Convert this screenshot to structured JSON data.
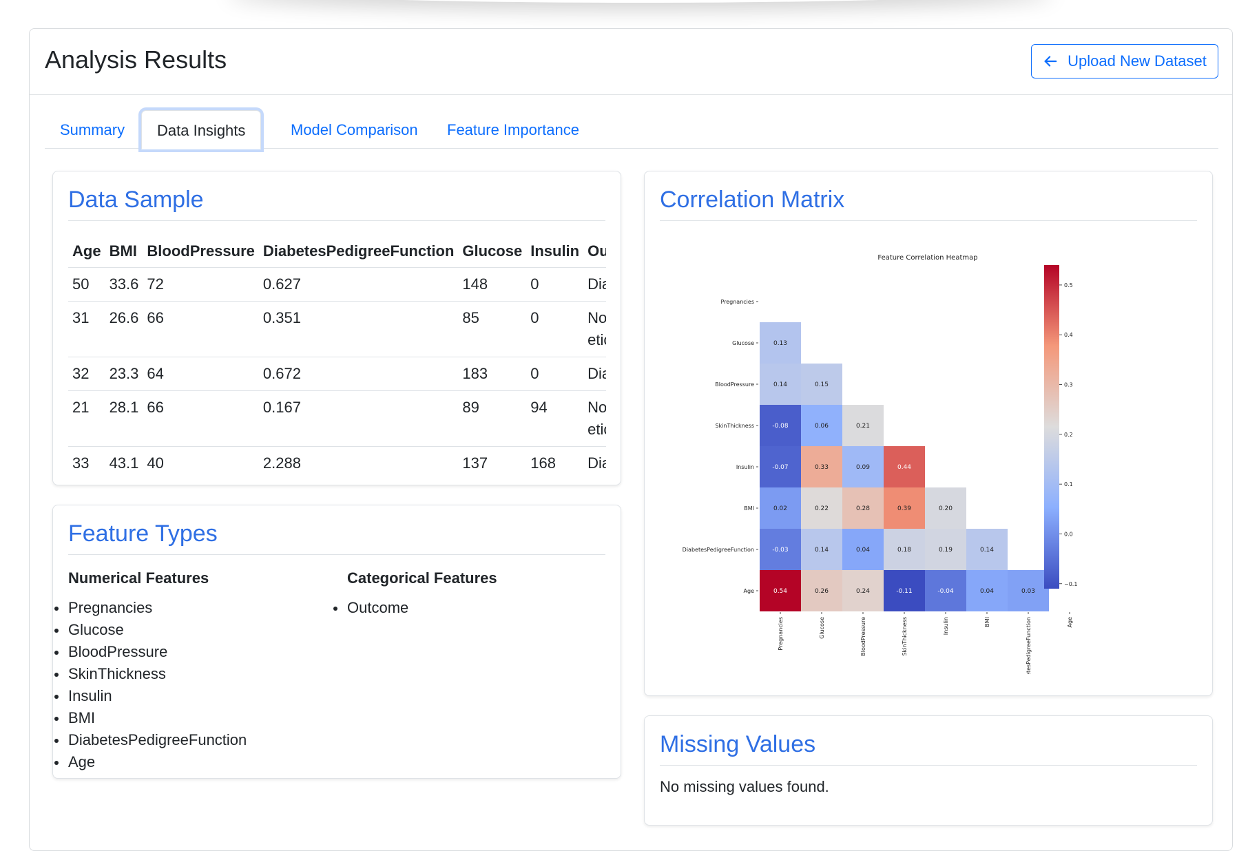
{
  "header": {
    "title": "Analysis Results",
    "upload_button": "Upload New Dataset"
  },
  "tabs": [
    {
      "label": "Summary",
      "active": false
    },
    {
      "label": "Data Insights",
      "active": true
    },
    {
      "label": "Model Comparison",
      "active": false
    },
    {
      "label": "Feature Importance",
      "active": false
    }
  ],
  "data_sample": {
    "title": "Data Sample",
    "columns": [
      "Age",
      "BMI",
      "BloodPressure",
      "DiabetesPedigreeFunction",
      "Glucose",
      "Insulin",
      "Outcome"
    ],
    "rows": [
      [
        "50",
        "33.6",
        "72",
        "0.627",
        "148",
        "0",
        "Diabetic"
      ],
      [
        "31",
        "26.6",
        "66",
        "0.351",
        "85",
        "0",
        "Non Diabetic"
      ],
      [
        "32",
        "23.3",
        "64",
        "0.672",
        "183",
        "0",
        "Diabetic"
      ],
      [
        "21",
        "28.1",
        "66",
        "0.167",
        "89",
        "94",
        "Non Diabetic"
      ],
      [
        "33",
        "43.1",
        "40",
        "2.288",
        "137",
        "168",
        "Diabetic"
      ]
    ]
  },
  "feature_types": {
    "title": "Feature Types",
    "numerical_heading": "Numerical Features",
    "numerical": [
      "Pregnancies",
      "Glucose",
      "BloodPressure",
      "SkinThickness",
      "Insulin",
      "BMI",
      "DiabetesPedigreeFunction",
      "Age"
    ],
    "categorical_heading": "Categorical Features",
    "categorical": [
      "Outcome"
    ]
  },
  "correlation": {
    "title": "Correlation Matrix"
  },
  "missing": {
    "title": "Missing Values",
    "message": "No missing values found."
  },
  "chart_data": {
    "type": "heatmap",
    "title": "Feature Correlation Heatmap",
    "variables": [
      "Pregnancies",
      "Glucose",
      "BloodPressure",
      "SkinThickness",
      "Insulin",
      "BMI",
      "DiabetesPedigreeFunction",
      "Age"
    ],
    "lower_triangle": [
      [],
      [
        0.13
      ],
      [
        0.14,
        0.15
      ],
      [
        -0.08,
        0.06,
        0.21
      ],
      [
        -0.07,
        0.33,
        0.09,
        0.44
      ],
      [
        0.02,
        0.22,
        0.28,
        0.39,
        0.2
      ],
      [
        -0.03,
        0.14,
        0.04,
        0.18,
        0.19,
        0.14
      ],
      [
        0.54,
        0.26,
        0.24,
        -0.11,
        -0.04,
        0.04,
        0.03
      ]
    ],
    "colormap": "coolwarm",
    "colorbar_range": [
      -0.11,
      0.54
    ],
    "colorbar_ticks": [
      "0.5",
      "0.4",
      "0.3",
      "0.2",
      "0.1",
      "0.0",
      "−0.1"
    ],
    "colorbar_tick_values": [
      0.5,
      0.4,
      0.3,
      0.2,
      0.1,
      0.0,
      -0.1
    ]
  },
  "colors": {
    "accent": "#0d6efd",
    "heading": "#2f6fe4"
  }
}
